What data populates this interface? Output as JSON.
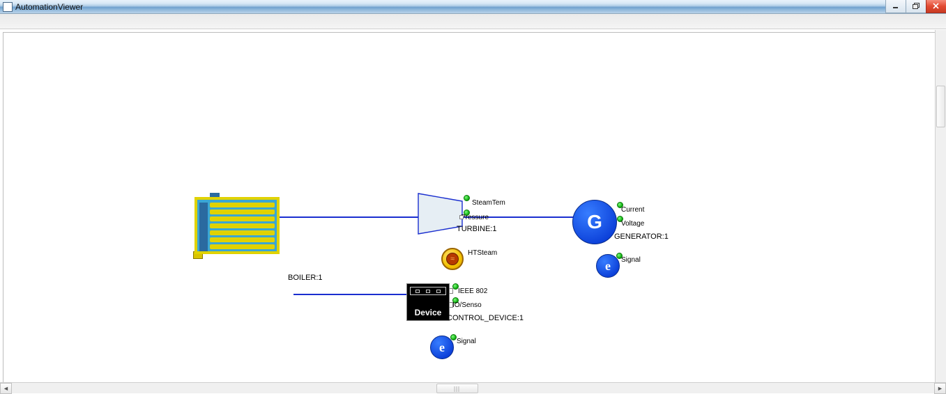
{
  "window": {
    "title": "AutomationViewer"
  },
  "nodes": {
    "boiler": {
      "label": "BOILER:1"
    },
    "turbine": {
      "label": "TURBINE:1",
      "ports": {
        "steamtem": "SteamTem",
        "pressure": "Pressure"
      }
    },
    "generator": {
      "label": "GENERATOR:1",
      "glyph": "G",
      "ports": {
        "current": "Current",
        "voltage": "Voltage"
      }
    },
    "ctrldev": {
      "label": "CONTROL_DEVICE:1",
      "caption": "Device",
      "ports": {
        "ieee": "IEEE 802",
        "io": "IO/Senso"
      }
    },
    "htsteam": {
      "label": "HTSteam"
    },
    "sig1": {
      "glyph": "e",
      "label": "Signal"
    },
    "sig2": {
      "glyph": "e",
      "label": "Signal"
    }
  }
}
